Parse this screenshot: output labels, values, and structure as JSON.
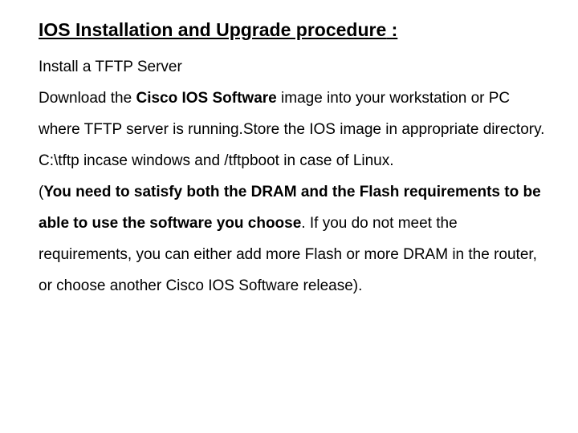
{
  "title_underline": "IOS Installation and Upgrade procedure",
  "title_tail": " :",
  "line1": "Install a TFTP Server",
  "line2a": "Download the ",
  "line2b": "Cisco IOS Software",
  "line2c": " image into your workstation or PC where TFTP server is running.Store the IOS image in appropriate directory. C:\\tftp incase windows and /tftpboot in case of Linux.",
  "line3a": "(",
  "line3b": "You need to satisfy both the DRAM and the Flash requirements to be able to use the software you choose",
  "line3c": ". If you do not meet the requirements, you can either add more Flash or more DRAM in the router, or choose another Cisco IOS Software release)."
}
